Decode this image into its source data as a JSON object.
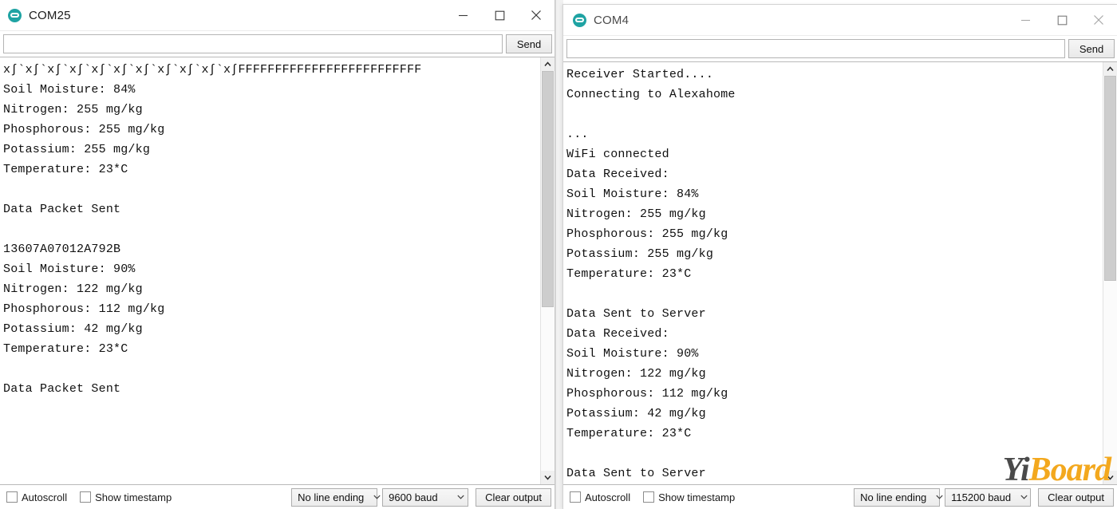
{
  "windows": [
    {
      "id": "com25",
      "title": "COM25",
      "icon": "arduino-serial-monitor-icon",
      "send": {
        "input_value": "",
        "input_placeholder": "",
        "button_label": "Send"
      },
      "console_text": "x∫`x∫`x∫`x∫`x∫`x∫`x∫`x∫`x∫`x∫`x∫FFFFFFFFFFFFFFFFFFFFFFFFF\nSoil Moisture: 84%\nNitrogen: 255 mg/kg\nPhosphorous: 255 mg/kg\nPotassium: 255 mg/kg\nTemperature: 23*C\n\nData Packet Sent\n\n13607A07012A792B\nSoil Moisture: 90%\nNitrogen: 122 mg/kg\nPhosphorous: 112 mg/kg\nPotassium: 42 mg/kg\nTemperature: 23*C\n\nData Packet Sent\n",
      "bottom": {
        "autoscroll_label": "Autoscroll",
        "autoscroll_checked": false,
        "timestamp_label": "Show timestamp",
        "timestamp_checked": false,
        "line_ending": "No line ending",
        "baud_rate": "9600 baud",
        "clear_label": "Clear output"
      },
      "controls": {
        "minimize": "minimize-icon",
        "maximize": "maximize-icon",
        "close": "close-icon"
      }
    },
    {
      "id": "com4",
      "title": "COM4",
      "icon": "arduino-serial-monitor-icon",
      "send": {
        "input_value": "",
        "input_placeholder": "",
        "button_label": "Send"
      },
      "console_text": "Receiver Started....\nConnecting to Alexahome\n\n...\nWiFi connected\nData Received:\nSoil Moisture: 84%\nNitrogen: 255 mg/kg\nPhosphorous: 255 mg/kg\nPotassium: 255 mg/kg\nTemperature: 23*C\n\nData Sent to Server\nData Received:\nSoil Moisture: 90%\nNitrogen: 122 mg/kg\nPhosphorous: 112 mg/kg\nPotassium: 42 mg/kg\nTemperature: 23*C\n\nData Sent to Server\n",
      "bottom": {
        "autoscroll_label": "Autoscroll",
        "autoscroll_checked": false,
        "timestamp_label": "Show timestamp",
        "timestamp_checked": false,
        "line_ending": "No line ending",
        "baud_rate": "115200 baud",
        "clear_label": "Clear output"
      },
      "controls": {
        "minimize": "minimize-icon",
        "maximize": "maximize-icon",
        "close": "close-icon"
      }
    }
  ],
  "watermark": {
    "part1": "Yi",
    "part2": "Board",
    "color1": "#4a4a4a",
    "color2": "#f3a81e"
  },
  "theme": {
    "accent": "#1fa3a3",
    "text": "#101010",
    "chrome": "#ffffff",
    "border": "#b9b9b9"
  }
}
